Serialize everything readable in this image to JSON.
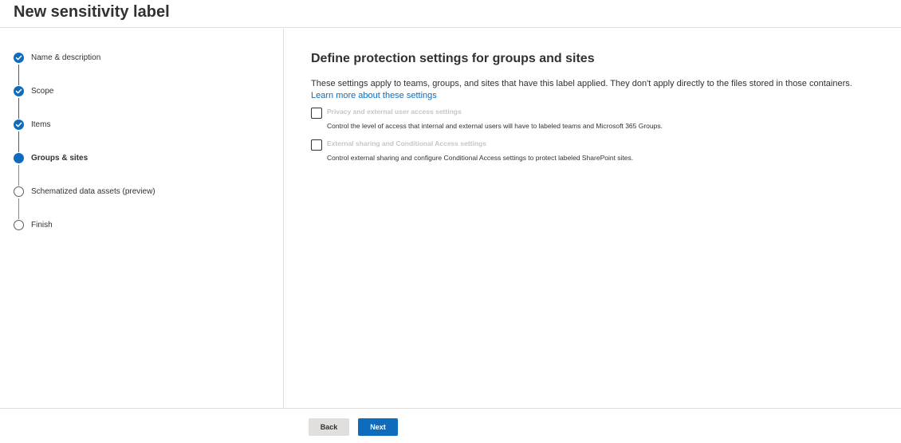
{
  "header": {
    "title": "New sensitivity label"
  },
  "wizard": {
    "steps": [
      {
        "label": "Name & description",
        "state": "done"
      },
      {
        "label": "Scope",
        "state": "done"
      },
      {
        "label": "Items",
        "state": "done"
      },
      {
        "label": "Groups & sites",
        "state": "current"
      },
      {
        "label": "Schematized data assets (preview)",
        "state": "todo"
      },
      {
        "label": "Finish",
        "state": "todo"
      }
    ]
  },
  "main": {
    "heading": "Define protection settings for groups and sites",
    "description": "These settings apply to teams, groups, and sites that have this label applied. They don't apply directly to the files stored in those containers.",
    "learn_link": "Learn more about these settings",
    "options": [
      {
        "title": "Privacy and external user access settings",
        "description": "Control the level of access that internal and external users will have to labeled teams and Microsoft 365 Groups.",
        "checked": false
      },
      {
        "title": "External sharing and Conditional Access settings",
        "description": "Control external sharing and configure Conditional Access settings to protect labeled SharePoint sites.",
        "checked": false
      }
    ]
  },
  "footer": {
    "back_label": "Back",
    "next_label": "Next"
  },
  "colors": {
    "accent": "#0f6cbd",
    "disabled_text": "#c8c6c4",
    "border": "#e1dfdd"
  }
}
